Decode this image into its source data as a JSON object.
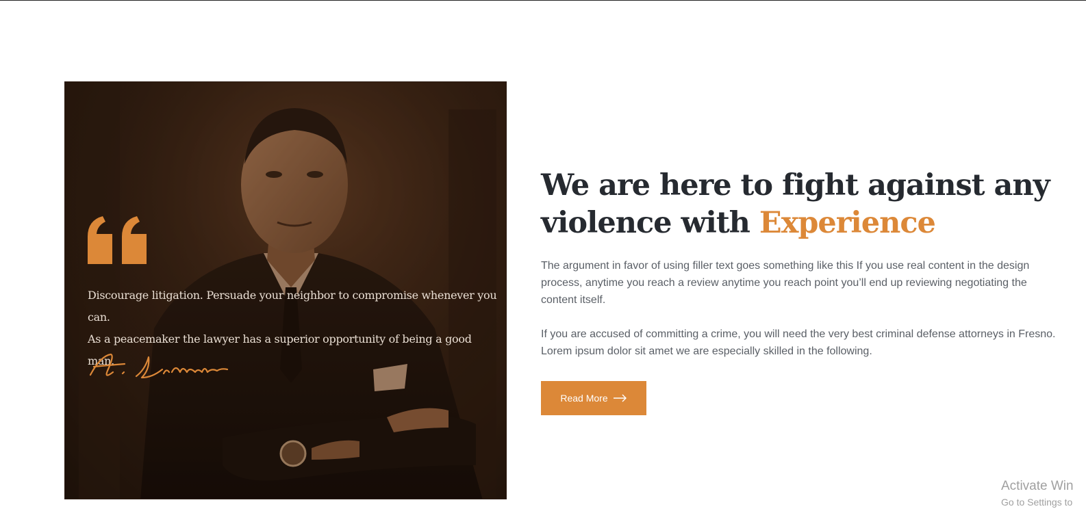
{
  "quote": {
    "line1": "Discourage litigation. Persuade your neighbor to compromise whenever you can.",
    "line2": "As a peacemaker the lawyer has a superior opportunity of being a good man.",
    "signature": "A. Lincoln"
  },
  "headline": {
    "part1": "We are here to fight against any violence with ",
    "accent": "Experience"
  },
  "paragraphs": {
    "p1": "The argument in favor of using filler text goes something like this If you use real content in the design process, anytime you reach a review anytime you reach point you’ll end up reviewing negotiating the content itself.",
    "p2": "If you are accused of committing a crime, you will need the very best criminal defense attorneys in Fresno. Lorem ipsum dolor sit amet we are especially skilled in the following."
  },
  "button": {
    "label": "Read More",
    "icon": "arrow-right-icon"
  },
  "watermark": {
    "line1": "Activate Win",
    "line2": "Go to Settings to"
  },
  "colors": {
    "accent": "#dc8838",
    "heading": "#262a30",
    "body": "#5a5f66",
    "photo_tint": "#3a2314"
  }
}
